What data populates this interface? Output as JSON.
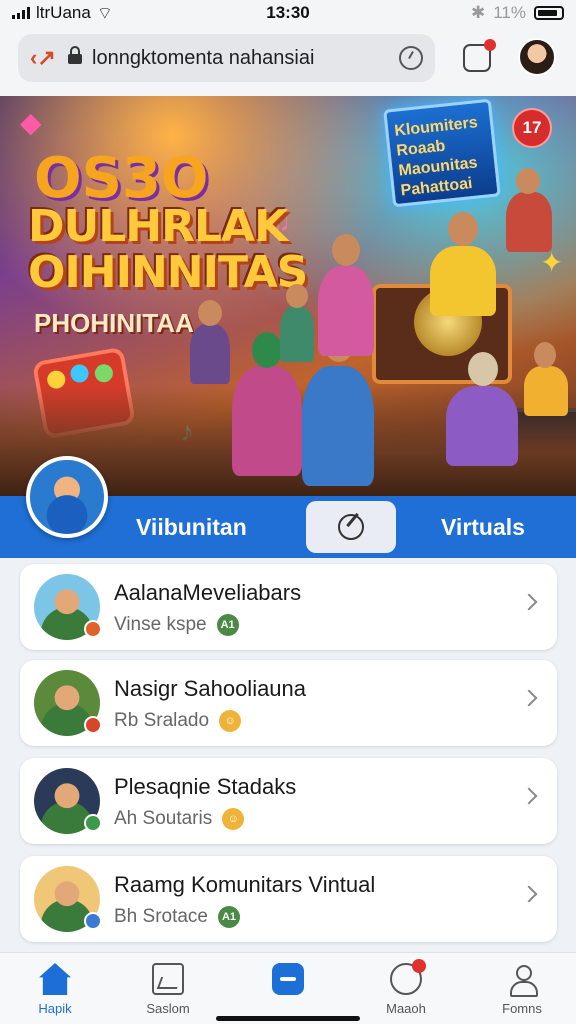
{
  "status": {
    "carrier": "ltrUana",
    "time": "13:30",
    "battery": "11%"
  },
  "browser": {
    "url": "lonngktomenta nahansiai"
  },
  "hero": {
    "logo_text": "OS3O",
    "title_line1": "DULHRLAK",
    "title_line2": "OIHINNITAS",
    "subtitle": "PHOHINITAA",
    "sign_text": "Kloumiters Roaab Maounitas Pahattoai",
    "badge": "17"
  },
  "tabstrip": {
    "left_label": "Viibunitan",
    "right_label": "Virtuals"
  },
  "list": {
    "items": [
      {
        "name": "AalanaMeveliabars",
        "sub": "Vinse kspe",
        "pill": "A1",
        "pill_color": "#4a8a45",
        "avatar_bg": "#7cc5e6",
        "mini_color": "#e0632a"
      },
      {
        "name": "Nasigr Sahooliauna",
        "sub": "Rb Sralado",
        "pill": "",
        "pill_color": "#f0b33a",
        "avatar_bg": "#5a8a3a",
        "mini_color": "#d6472a"
      },
      {
        "name": "Plesaqnie Stadaks",
        "sub": "Ah Soutaris",
        "pill": "",
        "pill_color": "#f0b33a",
        "avatar_bg": "#2a3a58",
        "mini_color": "#3a9a4a"
      },
      {
        "name": "Raamg Komunitars Vintual",
        "sub": "Bh Srotace",
        "pill": "A1",
        "pill_color": "#4a8a45",
        "avatar_bg": "#f0c777",
        "mini_color": "#3a7ad0"
      }
    ]
  },
  "bottom_nav": {
    "items": [
      {
        "label": "Hapik",
        "icon": "home-icon"
      },
      {
        "label": "Saslom",
        "icon": "calendar-icon"
      },
      {
        "label": "",
        "icon": "create-icon"
      },
      {
        "label": "Maaoh",
        "icon": "notifications-icon"
      },
      {
        "label": "Fomns",
        "icon": "profile-icon"
      }
    ]
  }
}
